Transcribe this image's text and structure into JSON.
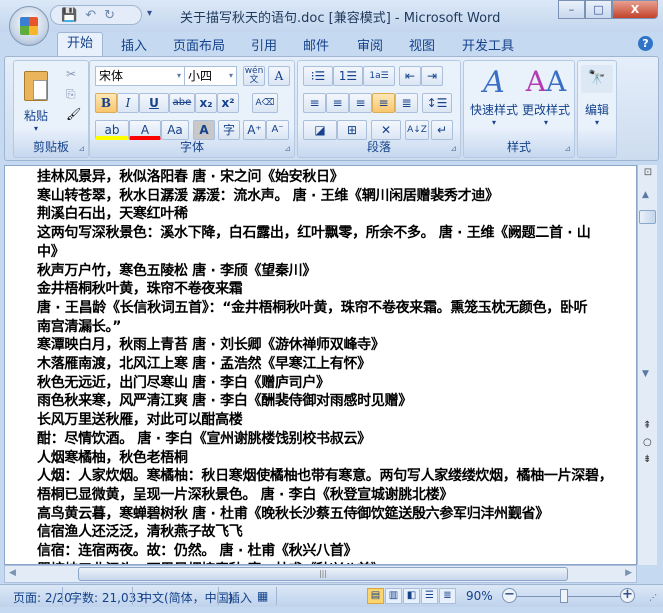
{
  "window": {
    "title": "关于描写秋天的语句.doc [兼容模式] - Microsoft Word",
    "minimize": "–",
    "maximize": "□",
    "close": "X"
  },
  "qat": {
    "save": "💾",
    "undo": "↶",
    "redo": "↻",
    "more": "▾"
  },
  "tabs": [
    "开始",
    "插入",
    "页面布局",
    "引用",
    "邮件",
    "审阅",
    "视图",
    "开发工具"
  ],
  "help": "?",
  "ribbon": {
    "clipboard": {
      "label": "剪贴板",
      "paste": "粘贴",
      "cut": "✂",
      "copy": "⎘",
      "format_painter": "🖌"
    },
    "font": {
      "label": "字体",
      "font_name": "宋体",
      "font_size": "小四",
      "phonetic": "wén文",
      "border_char": "A",
      "bold": "B",
      "italic": "I",
      "underline": "U",
      "strike": "abe",
      "subscript": "x₂",
      "superscript": "x²",
      "clear": "A⌫",
      "highlight": "ab",
      "font_color": "A",
      "change_case": "Aa",
      "shade": "A",
      "enclose": "字",
      "grow": "A⁺",
      "shrink": "A⁻",
      "highlight_color": "#ffff00",
      "font_color_value": "#ff0000"
    },
    "paragraph": {
      "label": "段落",
      "bullets": "⁝☰",
      "numbering": "1☰",
      "multilevel": "1a☰",
      "decrease_indent": "⇤",
      "increase_indent": "⇥",
      "align_left": "≡",
      "center": "≡",
      "align_right": "≡",
      "justify": "≡",
      "distributed": "≣",
      "line_spacing": "↕☰",
      "shading": "◪",
      "borders": "⊞",
      "asian_layout": "✕",
      "sort": "A↓Z",
      "show_marks": "↵"
    },
    "styles": {
      "label": "样式",
      "quick_styles": "快速样式",
      "change_styles": "更改样式"
    },
    "editing": {
      "label": "编辑",
      "icon": "🔭"
    }
  },
  "document": {
    "lines": [
      "挂林风景异，秋似洛阳春 唐 · 宋之问《始安秋日》",
      "寒山转苍翠，秋水日潺湲 潺湲：流水声。 唐 · 王维《辋川闲居赠裴秀才迪》",
      "荆溪白石出，天寒红叶稀",
      "这两句写深秋景色：溪水下降，白石露出，红叶飘零，所余不多。 唐 · 王维《阙题二首 · 山",
      "中》",
      "秋声万户竹，寒色五陵松 唐 · 李颀《望秦川》",
      "金井梧桐秋叶黄，珠帘不卷夜来霜",
      "唐 · 王昌龄《长信秋词五首》：“金井梧桐秋叶黄，珠帘不卷夜来霜。熏笼玉枕无颜色，卧听",
      "南宫清漏长。”",
      "寒潭映白月，秋雨上青苔 唐 · 刘长卿《游休禅师双峰寺》",
      "木落雁南渡，北风江上寒 唐 · 孟浩然《早寒江上有怀》",
      "秋色无远近，出门尽寒山 唐 · 李白《赠庐司户》",
      "雨色秋来寒，风严清江爽 唐 · 李白《酬裴侍御对雨感时见赠》",
      "长风万里送秋雁，对此可以酣高楼",
      "酣：尽情饮酒。 唐 · 李白《宣州谢朓楼饯别校书叔云》",
      "人烟寒橘柚，秋色老梧桐",
      "人烟：人家炊烟。寒橘柚：秋日寒烟使橘柚也带有寒意。两句写人家缕缕炊烟，橘柚一片深碧，",
      "梧桐已显微黄，呈现一片深秋景色。 唐 · 李白《秋登宣城谢朓北楼》",
      "高鸟黄云暮，寒蝉碧树秋 唐 · 杜甫《晚秋长沙蔡五侍御饮筵送殷六参军归沣州觐省》",
      "信宿渔人还泛泛，清秋燕子故飞飞",
      "信宿：连宿两夜。故：仍然。 唐 · 杜甫《秋兴八首》",
      "瞿塘峡口曲江头，万里风烟接素秋 唐 · 杜甫《秋兴八首》"
    ]
  },
  "statusbar": {
    "page": "页面: 2/20",
    "words": "字数: 21,033",
    "language": "中文(简体，中国)",
    "mode": "插入",
    "zoom": "90%",
    "zoom_percent": 90
  }
}
